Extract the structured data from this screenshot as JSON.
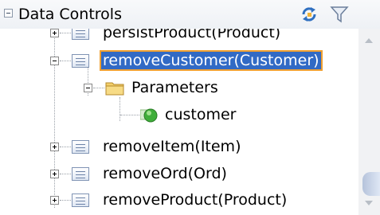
{
  "header": {
    "title": "Data Controls",
    "refresh_icon": "refresh-icon",
    "filter_icon": "filter-icon"
  },
  "tree": {
    "items": [
      {
        "label": "persistProduct(Product)",
        "state": "collapsed",
        "icon": "method-icon"
      },
      {
        "label": "removeCustomer(Customer)",
        "state": "expanded",
        "selected": true,
        "icon": "method-icon"
      },
      {
        "label": "Parameters",
        "state": "expanded",
        "icon": "folder-icon"
      },
      {
        "label": "customer",
        "icon": "parameter-icon"
      },
      {
        "label": "removeItem(Item)",
        "state": "collapsed",
        "icon": "method-icon"
      },
      {
        "label": "removeOrd(Ord)",
        "state": "collapsed",
        "icon": "method-icon"
      },
      {
        "label": "removeProduct(Product)",
        "state": "collapsed",
        "icon": "method-icon"
      }
    ]
  },
  "colors": {
    "selection": "#316ac5",
    "selection_border": "#f0a030",
    "folder": "#f3cf6a",
    "parameter": "#3fae3a"
  }
}
